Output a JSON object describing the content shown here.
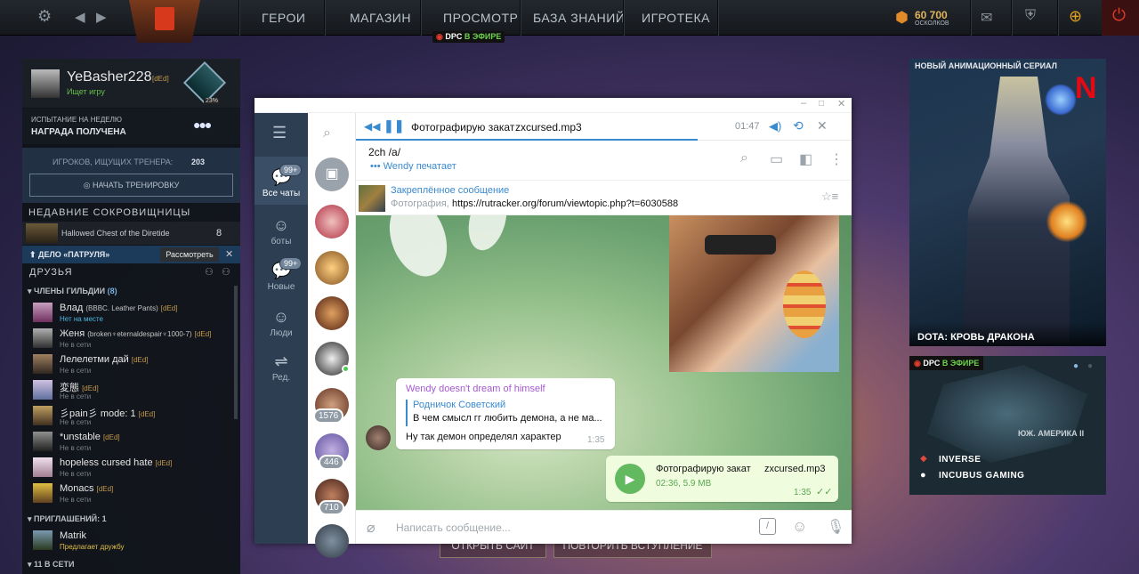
{
  "topbar": {
    "nav": [
      "ГЕРОИ",
      "МАГАЗИН",
      "ПРОСМОТР",
      "БАЗА ЗНАНИЙ",
      "ИГРОТЕКА"
    ],
    "dpc_label": "DPC",
    "dpc_live": "В ЭФИРЕ",
    "shards_value": "60 700",
    "shards_label": "ОСКОЛКОВ"
  },
  "profile": {
    "name": "YeBasher228",
    "tag": "[dEd]",
    "status": "Ищет игру",
    "rank_percent": "23%"
  },
  "weekly": {
    "line1": "ИСПЫТАНИЕ НА НЕДЕЛЮ",
    "line2": "НАГРАДА ПОЛУЧЕНА"
  },
  "coach": {
    "label": "ИГРОКОВ, ИЩУЩИХ ТРЕНЕРА:",
    "count": "203",
    "button": "НАЧАТЬ ТРЕНИРОВКУ"
  },
  "treasures": {
    "header": "НЕДАВНИЕ СОКРОВИЩНИЦЫ",
    "item": "Hallowed Chest of the Diretide",
    "count": "8"
  },
  "patrol": {
    "label": "ДЕЛО «ПАТРУЛЯ»",
    "button": "Рассмотреть",
    "close": "✕"
  },
  "friends": {
    "header": "ДРУЗЬЯ",
    "guild_header": "ЧЛЕНЫ ГИЛЬДИИ",
    "guild_count": "(8)",
    "list": [
      {
        "name": "Влад",
        "extra": "(BBBC. Leather Pants)",
        "tag": "[dEd]",
        "status": "Нет на месте"
      },
      {
        "name": "Женя",
        "extra": "(broken♆eternaldespair♆1000-7)",
        "tag": "[dEd]",
        "status": "Не в сети"
      },
      {
        "name": "Лелелетми дай",
        "extra": "",
        "tag": "[dEd]",
        "status": "Не в сети"
      },
      {
        "name": "変態",
        "extra": "",
        "tag": "[dEd]",
        "status": "Не в сети"
      },
      {
        "name": "彡pain彡 mode: 1",
        "extra": "",
        "tag": "[dEd]",
        "status": "Не в сети"
      },
      {
        "name": "*unstable",
        "extra": "",
        "tag": "[dEd]",
        "status": "Не в сети"
      },
      {
        "name": "hopeless cursed hate",
        "extra": "",
        "tag": "[dEd]",
        "status": "Не в сети"
      },
      {
        "name": "Monacs",
        "extra": "",
        "tag": "[dEd]",
        "status": "Не в сети"
      }
    ],
    "invites_header": "ПРИГЛАШЕНИЙ: 1",
    "invite": {
      "name": "Matrik",
      "status": "Предлагает дружбу"
    },
    "online_header": "11 В СЕТИ"
  },
  "telegram": {
    "rail": [
      {
        "label": "Все чаты",
        "badge": "99+"
      },
      {
        "label": "боты",
        "badge": ""
      },
      {
        "label": "Новые",
        "badge": "99+"
      },
      {
        "label": "Люди",
        "badge": ""
      },
      {
        "label": "Ред.",
        "badge": ""
      }
    ],
    "counters": [
      "1576",
      "446",
      "710"
    ],
    "player": {
      "title": "Фотографирую закат",
      "file": "zxcursed.mp3",
      "time": "01:47"
    },
    "chat": {
      "name": "2ch /a/",
      "typing": "Wendy печатает"
    },
    "pinned": {
      "title": "Закреплённое сообщение",
      "prefix": "Фотография,",
      "url": "https://rutracker.org/forum/viewtopic.php?t=6030588"
    },
    "msg1": {
      "author": "Wendy doesn't dream of himself",
      "reply_author": "Родничок Советский",
      "reply_text": "В чем смысл гг любить демона, а не ма...",
      "text": "Ну так демон определял характер",
      "time": "1:35"
    },
    "msg2": {
      "title": "Фотографирую закат",
      "file": "zxcursed.mp3",
      "meta": "02:36, 5.9 MB",
      "time": "1:35"
    },
    "input_placeholder": "Написать сообщение..."
  },
  "behind": {
    "btn1": "ОТКРЫТЬ САЙТ",
    "btn2": "ПОВТОРИТЬ ВСТУПЛЕНИЕ"
  },
  "right": {
    "series_label": "НОВЫЙ АНИМАЦИОННЫЙ СЕРИАЛ",
    "series_title": "DOTA: КРОВЬ ДРАКОНА",
    "dpc": "DPC",
    "dpc_live": "В ЭФИРЕ",
    "region": "ЮЖ. АМЕРИКА II",
    "team1": "INVERSE",
    "team2": "INCUBUS GAMING"
  }
}
